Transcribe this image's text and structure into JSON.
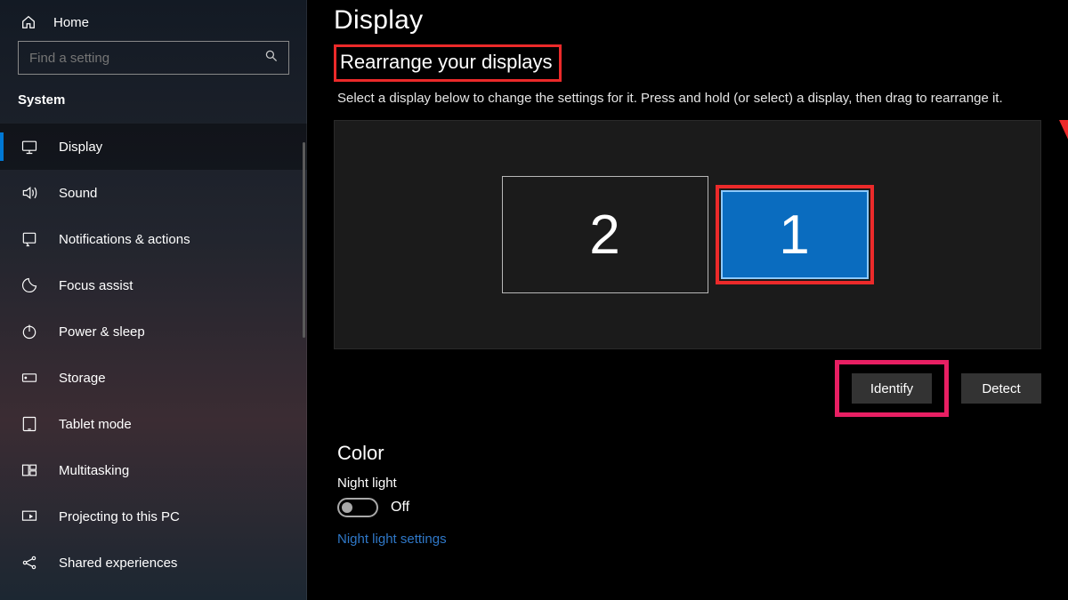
{
  "sidebar": {
    "home": "Home",
    "search_placeholder": "Find a setting",
    "section": "System",
    "items": [
      {
        "label": "Display",
        "active": true
      },
      {
        "label": "Sound"
      },
      {
        "label": "Notifications & actions"
      },
      {
        "label": "Focus assist"
      },
      {
        "label": "Power & sleep"
      },
      {
        "label": "Storage"
      },
      {
        "label": "Tablet mode"
      },
      {
        "label": "Multitasking"
      },
      {
        "label": "Projecting to this PC"
      },
      {
        "label": "Shared experiences"
      }
    ]
  },
  "main": {
    "title": "Display",
    "rearrange_heading": "Rearrange your displays",
    "rearrange_desc": "Select a display below to change the settings for it. Press and hold (or select) a display, then drag to rearrange it.",
    "monitor2": "2",
    "monitor1": "1",
    "identify": "Identify",
    "detect": "Detect",
    "color_heading": "Color",
    "night_light_label": "Night light",
    "night_light_state": "Off",
    "night_light_link": "Night light settings"
  },
  "annotations": {
    "arrow_color": "#ec2a2a",
    "highlight_red": "#ec2a2a",
    "highlight_pink": "#e81f63"
  }
}
